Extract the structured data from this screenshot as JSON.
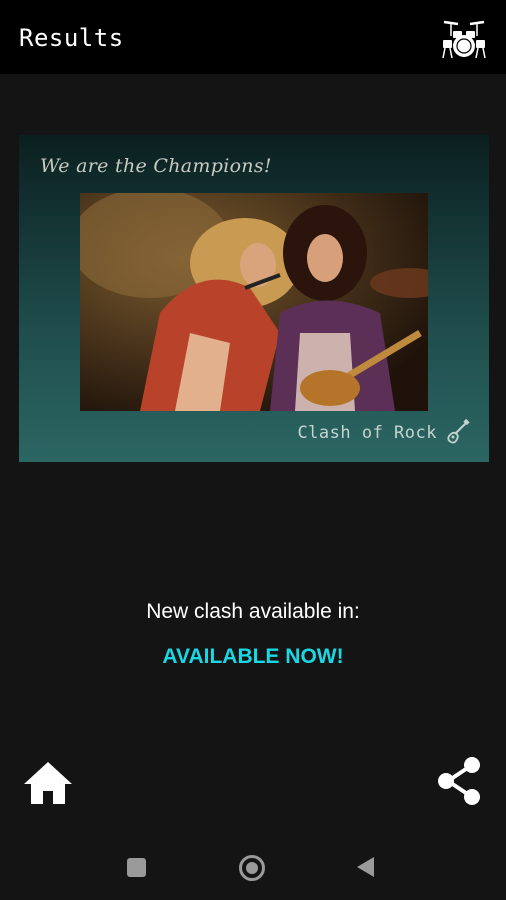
{
  "header": {
    "title": "Results",
    "drum_icon": "drum-kit-icon"
  },
  "card": {
    "headline": "We are the Champions!",
    "footer_text": "Clash of Rock",
    "footer_icon": "guitar-icon",
    "image_alt": "Two rock musicians performing on stage, a singer at a microphone and a guitarist"
  },
  "status": {
    "label": "New clash available in:",
    "value": "AVAILABLE NOW!",
    "value_color": "#19d8e3"
  },
  "actions": {
    "home_icon": "home-icon",
    "share_icon": "share-icon"
  },
  "system_nav": {
    "recents_icon": "recents-icon",
    "home_icon": "nav-home-icon",
    "back_icon": "back-icon"
  }
}
